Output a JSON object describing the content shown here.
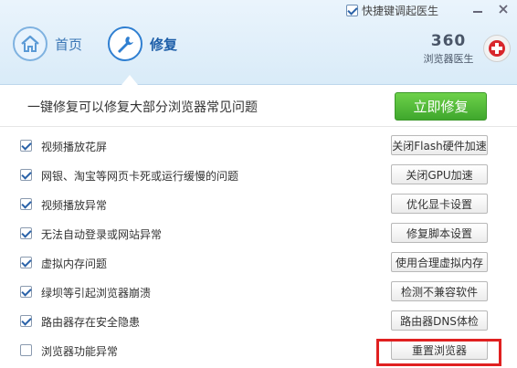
{
  "header": {
    "hotkey_label": "快捷键调起医生",
    "nav": [
      {
        "label": "首页",
        "icon": "home-icon"
      },
      {
        "label": "修复",
        "icon": "wrench-icon"
      }
    ],
    "logo_number": "360",
    "logo_name": "浏览器医生"
  },
  "main": {
    "title": "一键修复可以修复大部分浏览器常见问题",
    "fix_now_label": "立即修复"
  },
  "items": [
    {
      "label": "视频播放花屏",
      "checked": true,
      "button": "关闭Flash硬件加速"
    },
    {
      "label": "网银、淘宝等网页卡死或运行缓慢的问题",
      "checked": true,
      "button": "关闭GPU加速"
    },
    {
      "label": "视频播放异常",
      "checked": true,
      "button": "优化显卡设置"
    },
    {
      "label": "无法自动登录或网站异常",
      "checked": true,
      "button": "修复脚本设置"
    },
    {
      "label": "虚拟内存问题",
      "checked": true,
      "button": "使用合理虚拟内存"
    },
    {
      "label": "绿坝等引起浏览器崩溃",
      "checked": true,
      "button": "检测不兼容软件"
    },
    {
      "label": "路由器存在安全隐患",
      "checked": true,
      "button": "路由器DNS体检"
    },
    {
      "label": "浏览器功能异常",
      "checked": false,
      "button": "重置浏览器"
    }
  ],
  "colors": {
    "accent": "#2f7fd1",
    "fix_button": "#4cb834",
    "highlight": "#e02020"
  }
}
